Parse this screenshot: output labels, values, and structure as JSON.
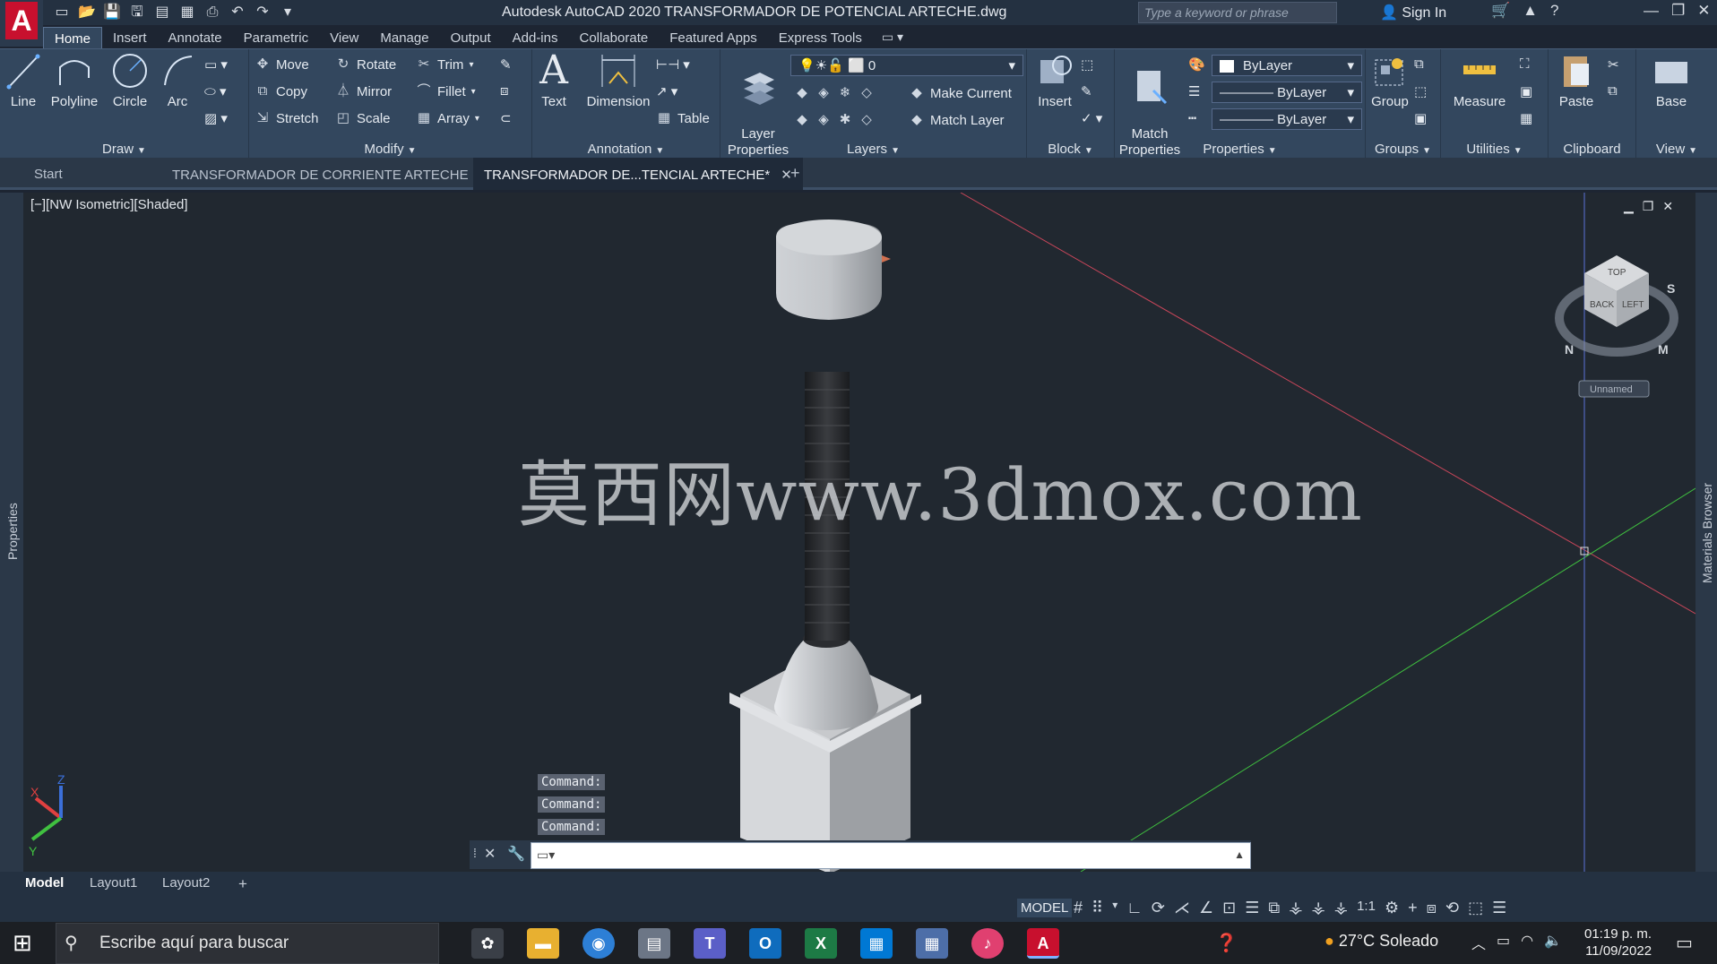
{
  "window": {
    "title": "Autodesk AutoCAD 2020   TRANSFORMADOR DE POTENCIAL ARTECHE.dwg",
    "logo_letter": "A",
    "search_placeholder": "Type a keyword or phrase",
    "sign_in": "Sign In"
  },
  "ribbon_tabs": [
    "Home",
    "Insert",
    "Annotate",
    "Parametric",
    "View",
    "Manage",
    "Output",
    "Add-ins",
    "Collaborate",
    "Featured Apps",
    "Express Tools"
  ],
  "ribbon": {
    "draw": {
      "title": "Draw",
      "line": "Line",
      "polyline": "Polyline",
      "circle": "Circle",
      "arc": "Arc"
    },
    "modify": {
      "title": "Modify",
      "move": "Move",
      "rotate": "Rotate",
      "trim": "Trim",
      "copy": "Copy",
      "mirror": "Mirror",
      "fillet": "Fillet",
      "stretch": "Stretch",
      "scale": "Scale",
      "array": "Array"
    },
    "annotation": {
      "title": "Annotation",
      "text": "Text",
      "dimension": "Dimension",
      "table": "Table"
    },
    "layers": {
      "title": "Layers",
      "layer_properties": "Layer\nProperties",
      "current_layer": "0",
      "make_current": "Make Current",
      "match_layer": "Match Layer"
    },
    "block": {
      "title": "Block",
      "insert": "Insert"
    },
    "properties": {
      "title": "Properties",
      "match_properties": "Match\nProperties",
      "color": "ByLayer",
      "linetype": "ByLayer",
      "lineweight": "ByLayer"
    },
    "groups": {
      "title": "Groups",
      "group": "Group"
    },
    "utilities": {
      "title": "Utilities",
      "measure": "Measure"
    },
    "clipboard": {
      "title": "Clipboard",
      "paste": "Paste"
    },
    "view": {
      "title": "View",
      "base": "Base"
    }
  },
  "doc_tabs": [
    {
      "label": "Start"
    },
    {
      "label": "TRANSFORMADOR DE CORRIENTE ARTECHE"
    },
    {
      "label": "TRANSFORMADOR DE...TENCIAL ARTECHE*"
    }
  ],
  "viewport": {
    "label": "[−][NW Isometric][Shaded]",
    "watermark": "莫西网www.3dmox.com",
    "viewcube_labels": {
      "top": "TOP",
      "back": "BACK",
      "left": "LEFT",
      "n": "N",
      "m": "M",
      "s": "S"
    },
    "ucs_name": "Unnamed",
    "left_palette": "Properties",
    "right_palette": "Materials Browser"
  },
  "command_history": [
    "Command:",
    "Command:",
    "Command:"
  ],
  "layout_tabs": [
    "Model",
    "Layout1",
    "Layout2"
  ],
  "status": {
    "model": "MODEL",
    "scale": "1:1"
  },
  "taskbar": {
    "search": "Escribe aquí para buscar",
    "weather": "27°C  Soleado",
    "time": "01:19 p. m.",
    "date": "11/09/2022"
  },
  "colors": {
    "accent": "#c8102e",
    "ribbon": "#33475e",
    "viewport": "#212830",
    "x_axis": "#d04a5a",
    "y_axis": "#3fbf3f"
  }
}
